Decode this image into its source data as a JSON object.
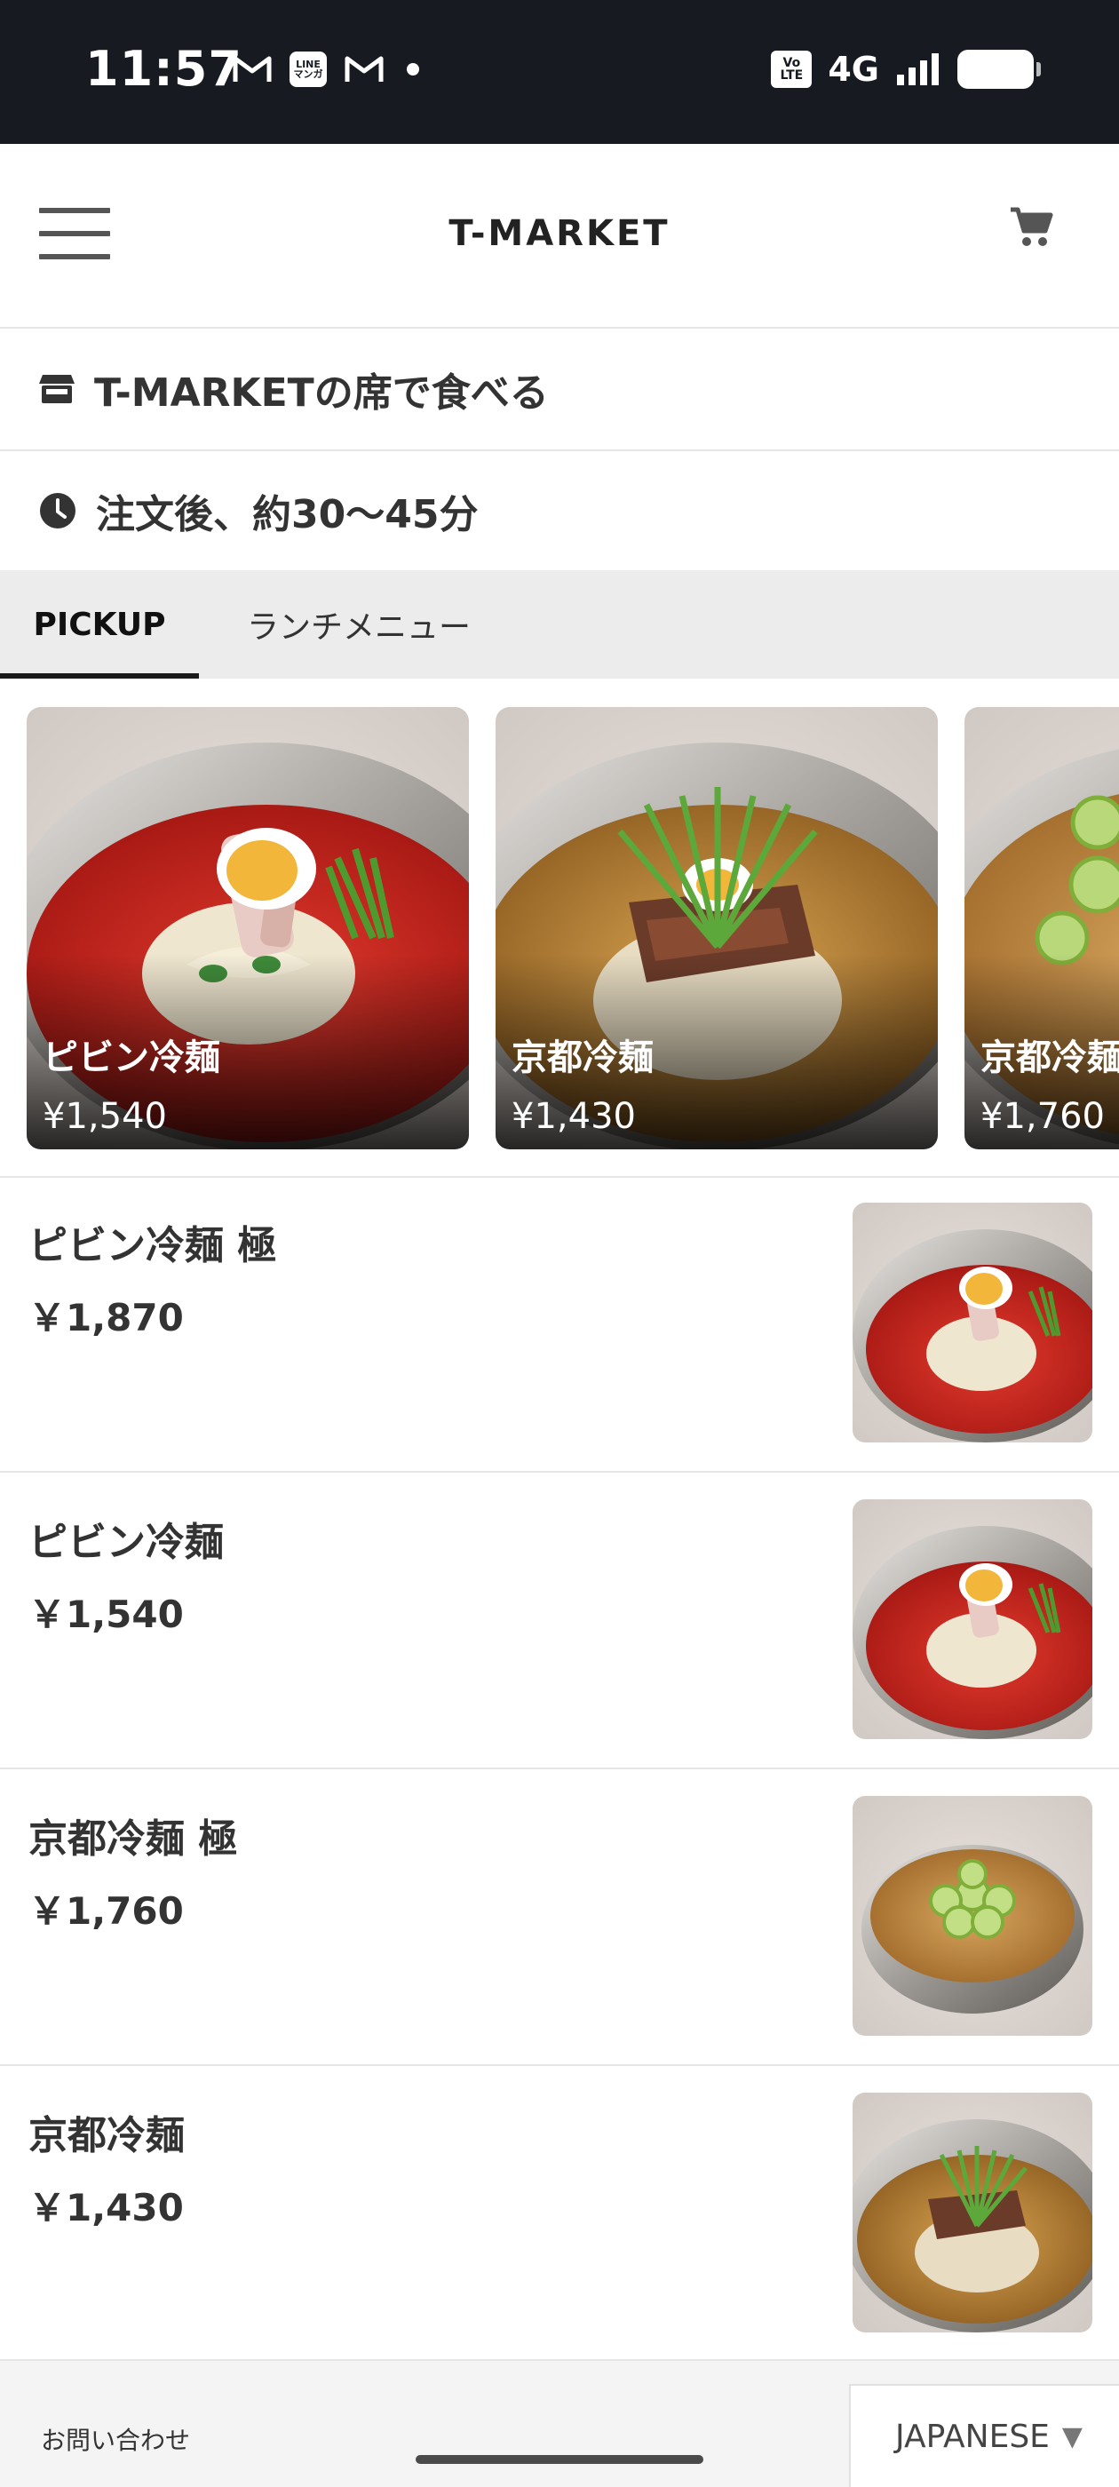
{
  "status_bar": {
    "time": "11:57",
    "network": "4G",
    "line_badge": "LINE\nマンガ",
    "volte_top": "Vo",
    "volte_bottom": "LTE",
    "icons": [
      "gmail-icon",
      "line-manga-icon",
      "gmail-icon",
      "dot-icon",
      "volte-icon",
      "signal-icon",
      "battery-icon"
    ]
  },
  "header": {
    "brand": "T-MARKET",
    "menu_icon": "hamburger-icon",
    "cart_icon": "cart-icon"
  },
  "info": {
    "dine_in": "T-MARKETの席で食べる",
    "dine_in_icon": "store-icon",
    "wait_time": "注文後、約30〜45分",
    "wait_time_icon": "clock-icon"
  },
  "tabs": [
    {
      "label": "PICKUP",
      "active": true
    },
    {
      "label": "ランチメニュー",
      "active": false
    }
  ],
  "pickup_cards": [
    {
      "name": "ピビン冷麺",
      "price": "¥1,540"
    },
    {
      "name": "京都冷麺",
      "price": "¥1,430"
    },
    {
      "name": "京都冷麺",
      "price": "¥1,760"
    }
  ],
  "menu_items": [
    {
      "name": "ピビン冷麺 極",
      "price": "￥1,870"
    },
    {
      "name": "ピビン冷麺",
      "price": "￥1,540"
    },
    {
      "name": "京都冷麺 極",
      "price": "￥1,760"
    },
    {
      "name": "京都冷麺",
      "price": "￥1,430"
    }
  ],
  "footer": {
    "contact": "お問い合わせ",
    "language": "JAPANESE"
  },
  "colors": {
    "status_bar_bg": "#171b21",
    "tab_bg": "#ececec",
    "text": "#333333",
    "divider": "#e6e6e6"
  }
}
